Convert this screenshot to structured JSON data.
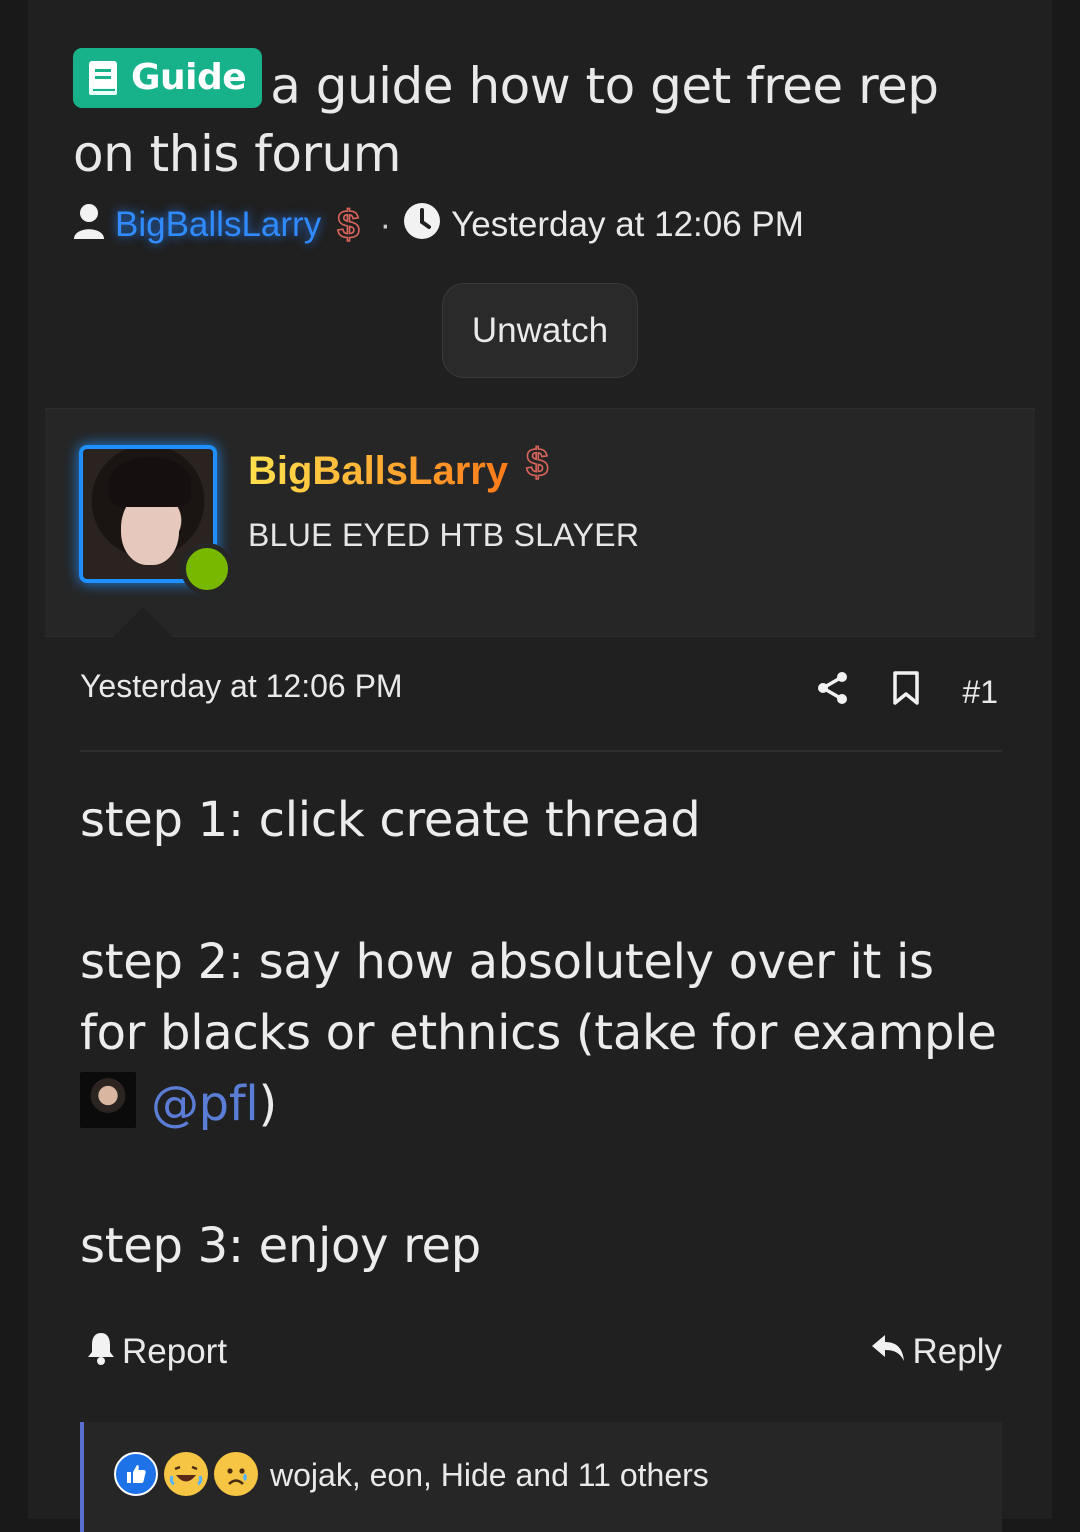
{
  "thread": {
    "prefix_label": "Guide",
    "prefix_icon": "book-icon",
    "prefix_color": "#18b28a",
    "title": "a guide how to get free rep on this forum",
    "author": "BigBallsLarry",
    "author_color": "#2f8bff",
    "dollar_symbol": "$",
    "separator": "·",
    "time": "Yesterday at 12:06 PM",
    "watch_button": "Unwatch"
  },
  "post": {
    "user": {
      "name": "BigBallsLarry",
      "title": "BLUE EYED HTB SLAYER",
      "online": true,
      "avatar_border_color": "#1e90ff"
    },
    "date": "Yesterday at 12:06 PM",
    "number": "#1",
    "body": {
      "step1": "step 1: click create thread",
      "step2": "step 2: say how absolutely over it is for blacks or ethnics (take for example ",
      "mention": "@pfl",
      "close_paren": ")",
      "step3": "step 3: enjoy rep"
    },
    "actions": {
      "report": "Report",
      "reply": "Reply"
    },
    "reactions": {
      "icons": [
        "like-icon",
        "laugh-icon",
        "sad-icon"
      ],
      "summary": "wojak, eon, Hide and 11 others"
    }
  }
}
